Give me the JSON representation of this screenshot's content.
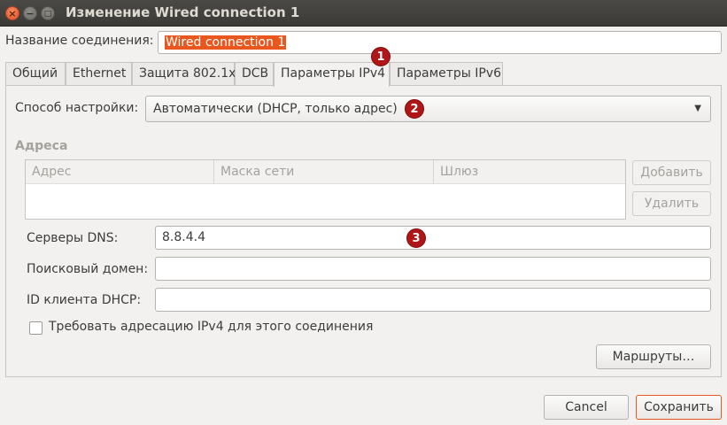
{
  "window": {
    "title": "Изменение Wired connection 1",
    "close_glyph": "×",
    "minimize_glyph": "−",
    "maximize_glyph": "□"
  },
  "connection_name": {
    "label": "Название соединения:",
    "value": "Wired connection 1"
  },
  "tabs": [
    {
      "label": "Общий"
    },
    {
      "label": "Ethernet"
    },
    {
      "label": "Защита 802.1x"
    },
    {
      "label": "DCB"
    },
    {
      "label": "Параметры IPv4"
    },
    {
      "label": "Параметры IPv6"
    }
  ],
  "active_tab": "Параметры IPv4",
  "method": {
    "label": "Способ настройки:",
    "value": "Автоматически (DHCP, только адрес)"
  },
  "addresses": {
    "section_label": "Адреса",
    "columns": [
      "Адрес",
      "Маска сети",
      "Шлюз"
    ],
    "add_button": "Добавить",
    "delete_button": "Удалить"
  },
  "dns": {
    "label": "Серверы DNS:",
    "value": "8.8.4.4"
  },
  "search_domain": {
    "label": "Поисковый домен:",
    "value": ""
  },
  "dhcp_client_id": {
    "label": "ID клиента DHCP:",
    "value": ""
  },
  "require_ipv4": {
    "label": "Требовать адресацию IPv4 для этого соединения",
    "checked": false
  },
  "routes_button": "Маршруты…",
  "footer": {
    "cancel": "Cancel",
    "save": "Сохранить"
  },
  "badges": [
    "1",
    "2",
    "3"
  ],
  "colors": {
    "accent": "#e9571e",
    "badge": "#b01518",
    "titlebar": "#3c3b37"
  }
}
